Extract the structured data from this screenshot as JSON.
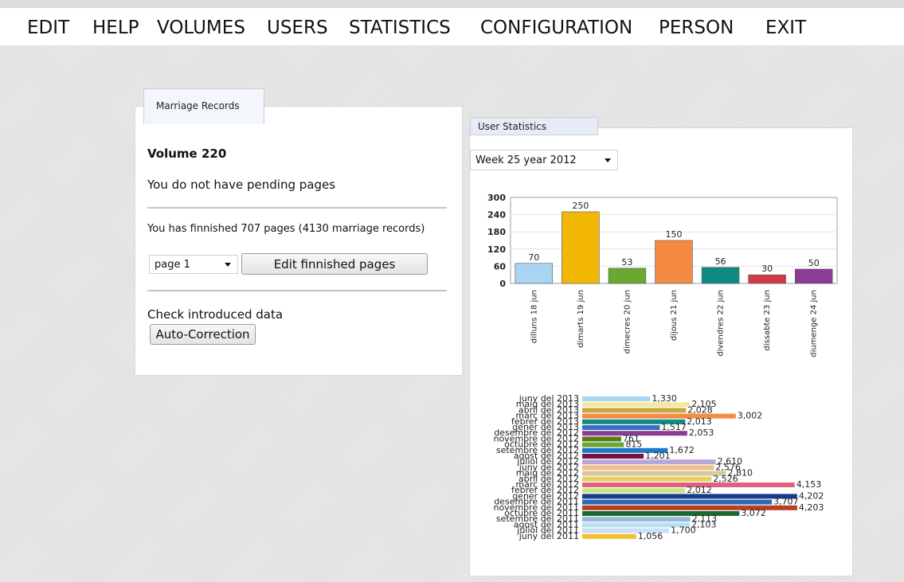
{
  "menu": [
    "EDIT",
    "HELP",
    "VOLUMES",
    "USERS",
    "STATISTICS",
    "CONFIGURATION",
    "PERSON",
    "EXIT"
  ],
  "left_panel": {
    "tab": "Marriage Records",
    "volume_title": "Volume 220",
    "pending_text": "You do not have pending pages",
    "finished_text": "You has finnished 707 pages (4130 marriage records)",
    "page_select_value": "page 1",
    "edit_button": "Edit finnished pages",
    "check_label": "Check introduced data",
    "auto_button": "Auto-Correction"
  },
  "right_panel": {
    "tab": "User Statistics",
    "week_select_value": "Week 25 year 2012"
  },
  "chart_data": [
    {
      "type": "bar",
      "categories": [
        "dilluns 18 jun",
        "dimarts 19 jun",
        "dimecres 20 jun",
        "dijous 21 jun",
        "divendres 22 jun",
        "dissabte 23 jun",
        "diumenge 24 jun"
      ],
      "values": [
        70,
        250,
        53,
        150,
        56,
        30,
        50
      ],
      "colors": [
        "#a9d4f2",
        "#f2b705",
        "#6aa832",
        "#f58a42",
        "#0f8a83",
        "#d23a45",
        "#8a3d94"
      ],
      "yticks": [
        0,
        60,
        120,
        180,
        240,
        300
      ],
      "ylim": [
        0,
        300
      ],
      "grid": true
    },
    {
      "type": "bar",
      "orientation": "horizontal",
      "categories": [
        "juny del 2013",
        "maig del 2013",
        "abril del 2013",
        "març del 2013",
        "febrer del 2013",
        "gener del 2013",
        "desembre del 2012",
        "novembre del 2012",
        "octubre del 2012",
        "setembre del 2012",
        "agost del 2012",
        "juliol del 2012",
        "juny del 2012",
        "maig del 2012",
        "abril del 2012",
        "març del 2012",
        "febrer del 2012",
        "gener del 2012",
        "desembre del 2011",
        "novembre del 2011",
        "octubre del 2011",
        "setembre del 2011",
        "agost del 2011",
        "juliol del 2011",
        "juny del 2011"
      ],
      "values": [
        1330,
        2105,
        2028,
        3002,
        2013,
        1517,
        2053,
        761,
        815,
        1672,
        1201,
        2610,
        2576,
        2810,
        2526,
        4153,
        2012,
        4202,
        3707,
        4203,
        3072,
        2113,
        2103,
        1700,
        1056
      ],
      "value_labels": [
        "1,330",
        "2,105",
        "2,028",
        "3,002",
        "2,013",
        "1,517",
        "2,053",
        "761",
        "815",
        "1,672",
        "1,201",
        "2,610",
        "2,576",
        "2,810",
        "2,526",
        "4,153",
        "2,012",
        "4,202",
        "3,707",
        "4,203",
        "3,072",
        "2,113",
        "2,103",
        "1,700",
        "1,056"
      ],
      "colors": [
        "#a9d4f2",
        "#f2e8a0",
        "#c8a640",
        "#f58a42",
        "#0f8a83",
        "#3b6fc4",
        "#8a3d94",
        "#5c7a1a",
        "#6aa832",
        "#1e78c8",
        "#7a1040",
        "#b8a6d8",
        "#f2c080",
        "#d8c8a0",
        "#e8d060",
        "#e06080",
        "#c8e880",
        "#1a3a8a",
        "#2a6ab8",
        "#b84020",
        "#1a6a30",
        "#9ab8d8",
        "#b8e0f0",
        "#c8e0f8",
        "#f2c030"
      ],
      "xlim": [
        0,
        4500
      ]
    }
  ]
}
